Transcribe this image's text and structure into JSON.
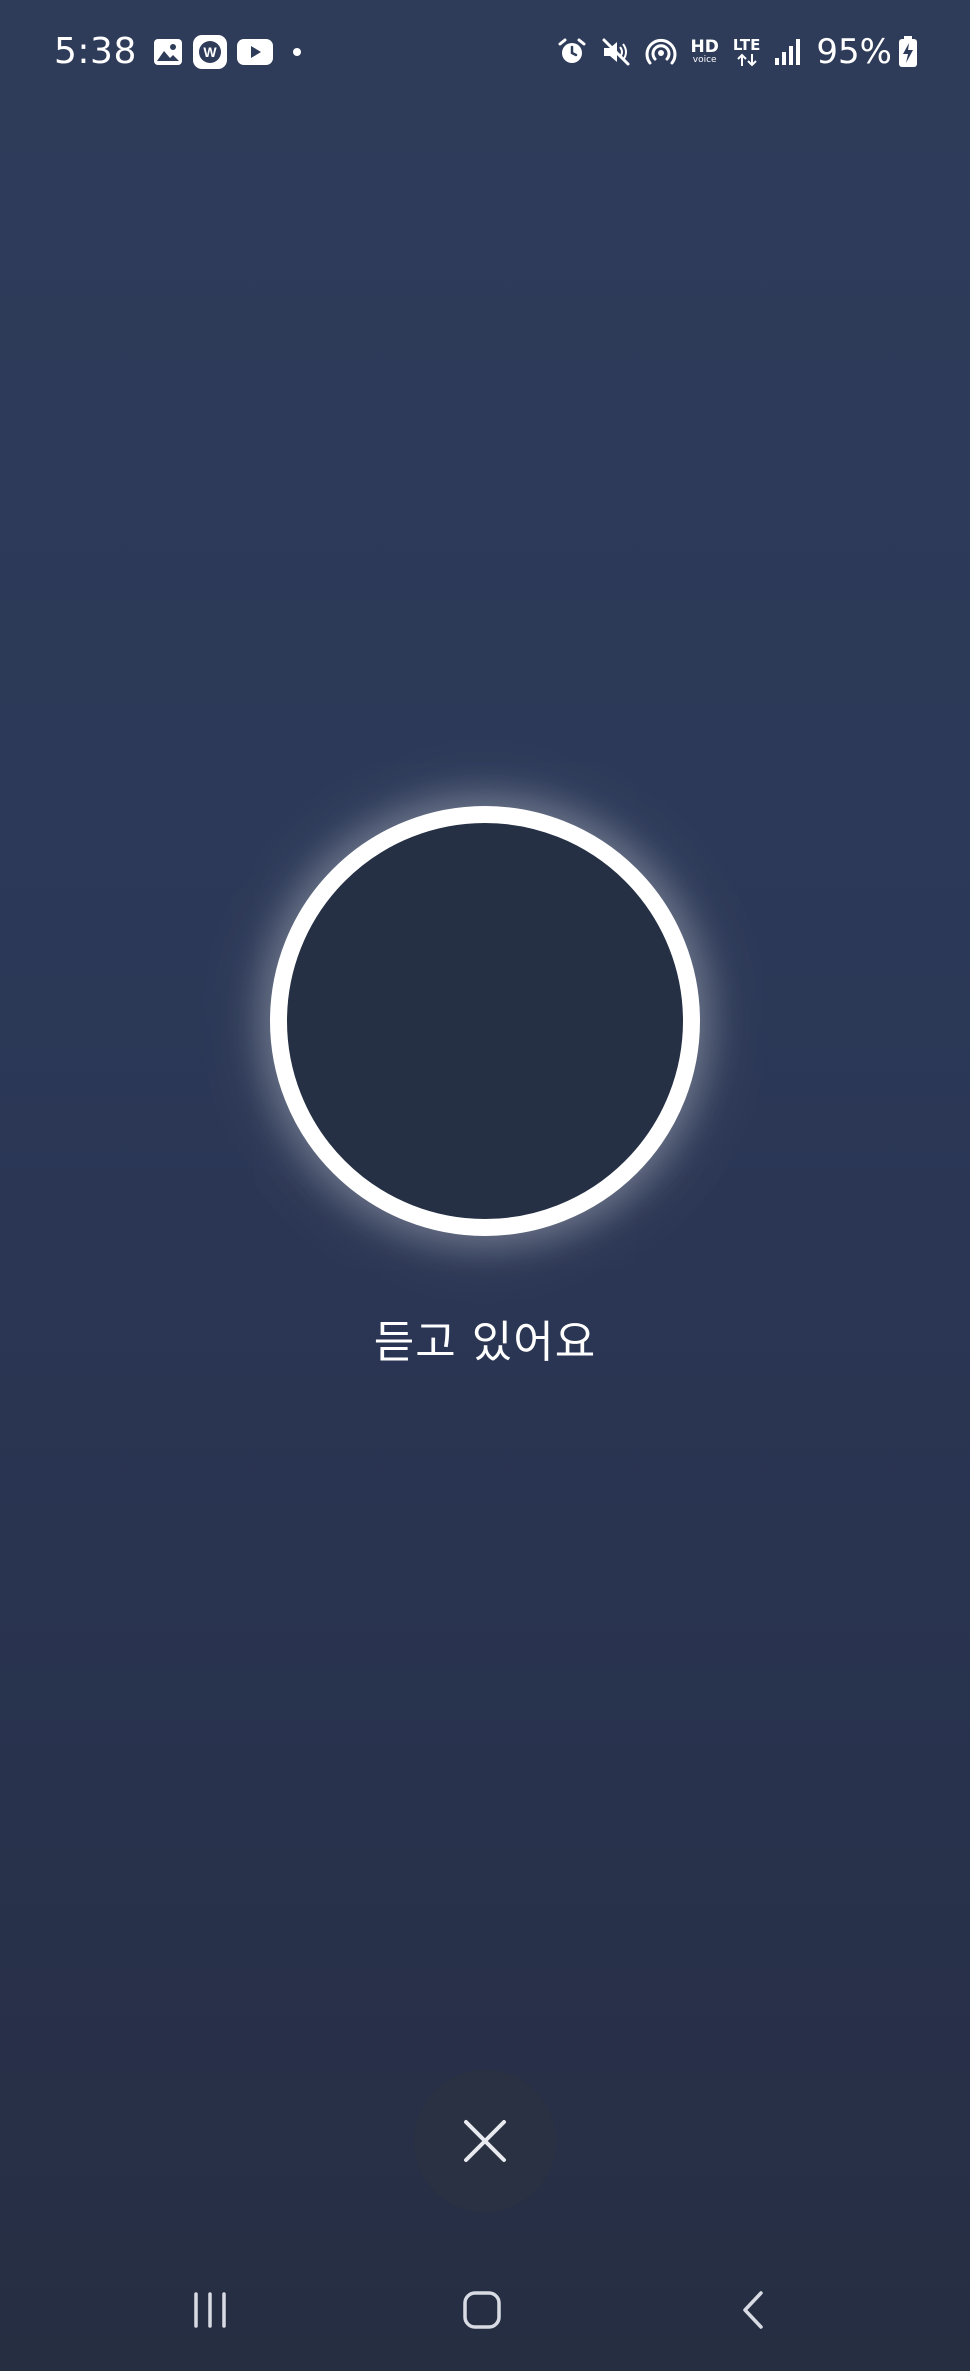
{
  "status_bar": {
    "time": "5:38",
    "battery_percent": "95%",
    "hd_label": "HD",
    "voice_label": "voice",
    "lte_label": "LTE",
    "left_icons": [
      "gallery-icon",
      "w-app-icon",
      "youtube-icon",
      "notification-dot"
    ],
    "right_icons": [
      "alarm-icon",
      "mute-icon",
      "hotspot-icon",
      "hd-voice-icon",
      "lte-icon",
      "signal-icon",
      "battery-charging-icon"
    ]
  },
  "voice": {
    "status_text": "듣고 있어요",
    "close_icon": "close-icon"
  },
  "nav_bar": {
    "buttons": [
      "recents-icon",
      "home-icon",
      "back-icon"
    ]
  },
  "colors": {
    "background_top": "#2e3c5a",
    "background_bottom": "#262e42",
    "orb_fill": "#253044",
    "orb_ring": "#ffffff",
    "close_button_bg": "#2a3142"
  }
}
